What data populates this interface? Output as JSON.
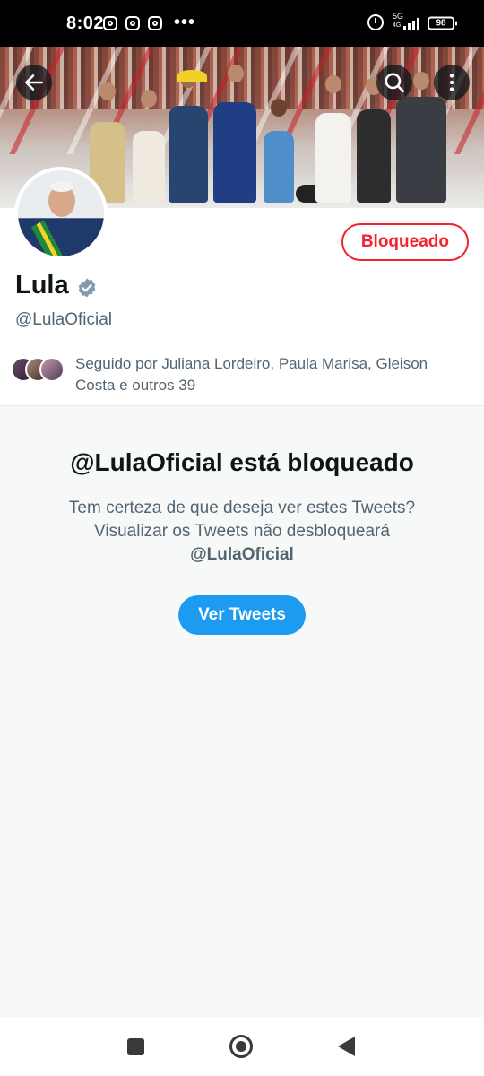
{
  "status_bar": {
    "time": "8:02",
    "dots": "•••",
    "network": "5G",
    "network_sub": "4G",
    "battery": "98"
  },
  "profile": {
    "name": "Lula",
    "handle": "@LulaOficial",
    "blocked_button": "Bloqueado",
    "followed_by": "Seguido por Juliana Lordeiro, Paula Marisa, Gleison Costa e outros 39",
    "verified_color": "#829aab"
  },
  "blocked": {
    "title": "@LulaOficial está bloqueado",
    "message": "Tem certeza de que deseja ver estes Tweets? Visualizar os Tweets não desbloqueará",
    "handle": "@LulaOficial",
    "view_button": "Ver Tweets"
  },
  "colors": {
    "accent": "#1d9bf0",
    "blocked": "#f4212e",
    "muted_text": "#536471"
  },
  "icons": [
    "back-arrow-icon",
    "search-icon",
    "more-vertical-icon",
    "verified-badge-icon",
    "instagram-icon",
    "alarm-icon",
    "signal-icon",
    "battery-icon"
  ]
}
